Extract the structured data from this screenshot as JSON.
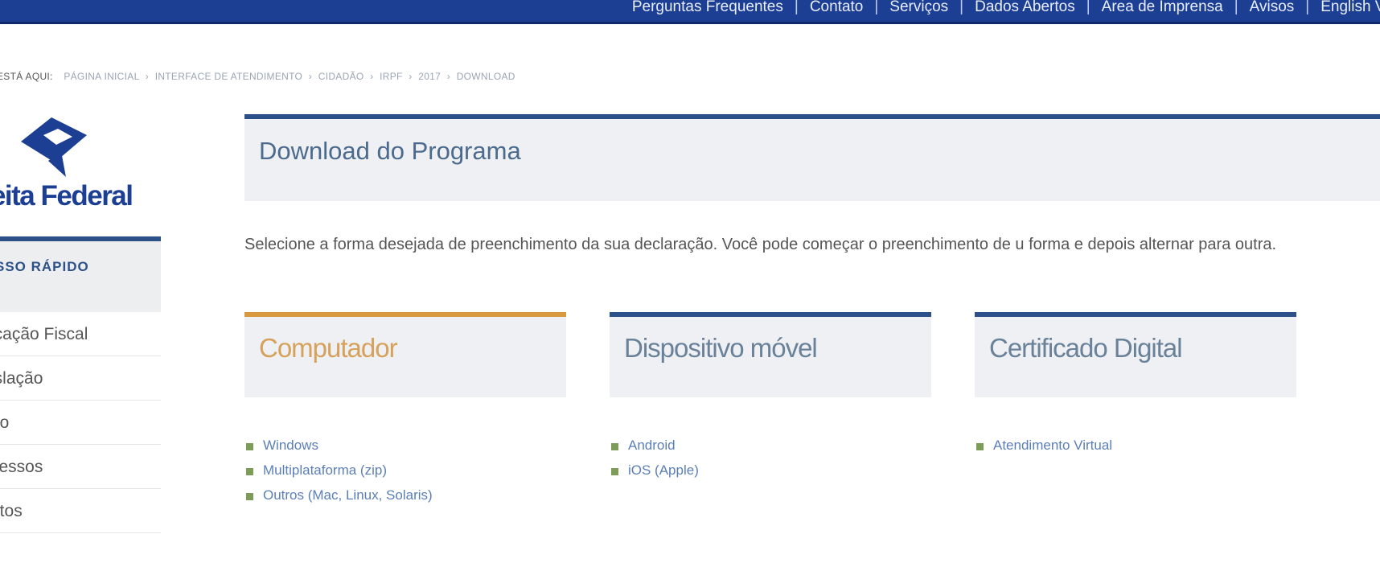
{
  "topnav": {
    "items": [
      {
        "label": "Perguntas Frequentes"
      },
      {
        "label": "Contato"
      },
      {
        "label": "Serviços"
      },
      {
        "label": "Dados Abertos"
      },
      {
        "label": "Área de Imprensa"
      },
      {
        "label": "Avisos"
      },
      {
        "label": "English Ve"
      }
    ],
    "separator": "|"
  },
  "breadcrumb": {
    "label": "ESTÁ AQUI:",
    "crumbs": [
      "PÁGINA INICIAL",
      "INTERFACE DE ATENDIMENTO",
      "CIDADÃO",
      "IRPF",
      "2017",
      "DOWNLOAD"
    ],
    "separator": "›"
  },
  "logo": {
    "name": "ceita Federal"
  },
  "sidebar": {
    "header": "SSO RÁPIDO",
    "items": [
      "icação Fiscal",
      "islação",
      "ão",
      "cessos",
      "utos"
    ]
  },
  "main": {
    "title": "Download do Programa",
    "intro": "Selecione a forma desejada de preenchimento da sua declaração. Você pode começar o preenchimento de u forma e depois alternar para outra."
  },
  "cards": [
    {
      "title": "Computador",
      "links": [
        "Windows",
        "Multiplataforma (zip)",
        "Outros (Mac, Linux, Solaris)"
      ]
    },
    {
      "title": "Dispositivo móvel",
      "links": [
        "Android",
        "iOS (Apple)"
      ]
    },
    {
      "title": "Certificado Digital",
      "links": [
        "Atendimento Virtual"
      ]
    }
  ],
  "colors": {
    "topbar": "#1c3f94",
    "accent_blue": "#2c5189",
    "accent_orange": "#d89a3c",
    "link": "#5b7fb7",
    "bullet": "#7d9c58"
  },
  "icons": {
    "logo": "receita-federal-logo-icon",
    "bullet": "link-bullet-icon"
  }
}
